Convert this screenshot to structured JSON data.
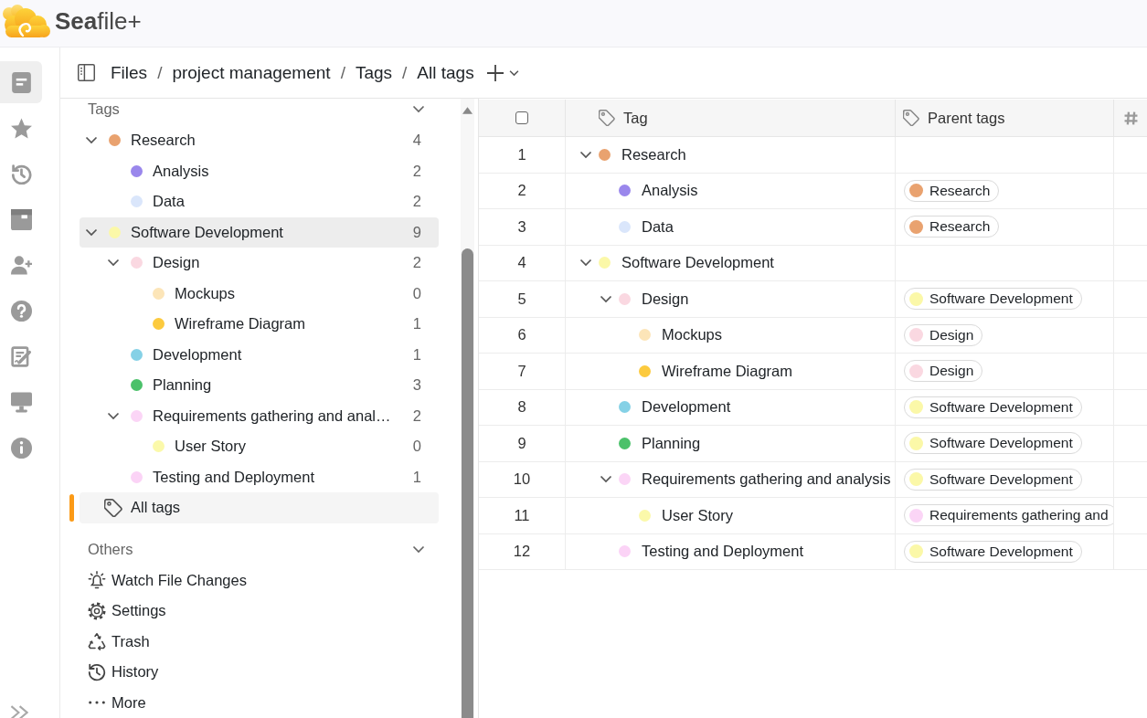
{
  "header": {
    "logo": "**Sea**file+"
  },
  "nav_rail": {
    "items": [
      {
        "selected": true
      },
      {
        "selected": false
      },
      {
        "selected": false
      },
      {
        "selected": false
      },
      {
        "selected": false
      },
      {
        "selected": false
      },
      {
        "selected": false
      },
      {
        "selected": false
      },
      {
        "selected": false
      }
    ]
  },
  "breadcrumb": [
    {
      "kind": "link",
      "text": "Files"
    },
    {
      "kind": "separator",
      "text": "/"
    },
    {
      "kind": "link",
      "text": "project management"
    },
    {
      "kind": "separator",
      "text": "/"
    },
    {
      "kind": "link",
      "text": "Tags"
    },
    {
      "kind": "separator",
      "text": "/"
    },
    {
      "kind": "current",
      "text": "All tags"
    }
  ],
  "sidebar": {
    "tags_section": {
      "title": "Tags",
      "expanded": true,
      "items": [
        {
          "name": "Research",
          "color": "#e9a26f",
          "count": "4",
          "expanded": true,
          "highlighted": false,
          "children": [
            {
              "name": "Analysis",
              "color": "#9a87ec",
              "count": "2",
              "highlighted": false
            },
            {
              "name": "Data",
              "color": "#dae6fb",
              "count": "2",
              "highlighted": false
            }
          ]
        },
        {
          "name": "Software Development",
          "color": "#fbf8a8",
          "count": "9",
          "expanded": true,
          "highlighted": true,
          "children": [
            {
              "name": "Design",
              "color": "#fad8e1",
              "count": "2",
              "expanded": true,
              "highlighted": false,
              "children": [
                {
                  "name": "Mockups",
                  "color": "#fce5b8",
                  "count": "0",
                  "highlighted": false
                },
                {
                  "name": "Wireframe Diagram",
                  "color": "#fcca3e",
                  "count": "1",
                  "highlighted": false
                }
              ]
            },
            {
              "name": "Development",
              "color": "#85d1e6",
              "count": "1",
              "highlighted": false
            },
            {
              "name": "Planning",
              "color": "#4bc16a",
              "count": "3",
              "highlighted": false
            },
            {
              "name": "Requirements gathering and anal…",
              "color": "#fbd5f6",
              "count": "2",
              "expanded": true,
              "highlighted": false,
              "children": [
                {
                  "name": "User Story",
                  "color": "#fbf9aa",
                  "count": "0",
                  "highlighted": false
                }
              ]
            },
            {
              "name": "Testing and Deployment",
              "color": "#fbd3f6",
              "count": "1",
              "highlighted": false
            }
          ]
        }
      ],
      "all_tags": {
        "label": "All tags",
        "selected": true
      }
    },
    "others_section": {
      "title": "Others",
      "expanded": true,
      "items": [
        {
          "label": "Watch File Changes"
        },
        {
          "label": "Settings"
        },
        {
          "label": "Trash"
        },
        {
          "label": "History"
        },
        {
          "label": "More"
        }
      ]
    }
  },
  "table": {
    "columns": [
      {
        "kind": "checkbox",
        "checked": false
      },
      {
        "kind": "tag",
        "label": "Tag"
      },
      {
        "kind": "tag",
        "label": "Parent tags"
      },
      {
        "kind": "number"
      }
    ],
    "rows": [
      {
        "number": "1",
        "name": "Research",
        "color": "#e9a26f",
        "expanded": true,
        "children": [
          {
            "number": "2",
            "name": "Analysis",
            "color": "#9a87ec",
            "parents": [
              {
                "name": "Research",
                "color": "#e9a26f"
              }
            ]
          },
          {
            "number": "3",
            "name": "Data",
            "color": "#dae6fb",
            "parents": [
              {
                "name": "Research",
                "color": "#e9a26f"
              }
            ]
          }
        ]
      },
      {
        "number": "4",
        "name": "Software Development",
        "color": "#fbf8a8",
        "expanded": true,
        "children": [
          {
            "number": "5",
            "name": "Design",
            "color": "#fad8e1",
            "expanded": true,
            "parents": [
              {
                "name": "Software Development",
                "color": "#fbf8a8"
              }
            ],
            "children": [
              {
                "number": "6",
                "name": "Mockups",
                "color": "#fce5b8",
                "parents": [
                  {
                    "name": "Design",
                    "color": "#fad8e1"
                  }
                ]
              },
              {
                "number": "7",
                "name": "Wireframe Diagram",
                "color": "#fcca3e",
                "parents": [
                  {
                    "name": "Design",
                    "color": "#fad8e1"
                  }
                ]
              }
            ]
          },
          {
            "number": "8",
            "name": "Development",
            "color": "#85d1e6",
            "parents": [
              {
                "name": "Software Development",
                "color": "#fbf8a8"
              }
            ]
          },
          {
            "number": "9",
            "name": "Planning",
            "color": "#4bc16a",
            "parents": [
              {
                "name": "Software Development",
                "color": "#fbf8a8"
              }
            ]
          },
          {
            "number": "10",
            "name": "Requirements gathering and analysis",
            "color": "#fbd5f6",
            "expanded": true,
            "parents": [
              {
                "name": "Software Development",
                "color": "#fbf8a8"
              }
            ],
            "children": [
              {
                "number": "11",
                "name": "User Story",
                "color": "#fbf9aa",
                "parents": [
                  {
                    "name": "Requirements gathering and",
                    "color": "#fbd5f6"
                  }
                ]
              }
            ]
          },
          {
            "number": "12",
            "name": "Testing and Deployment",
            "color": "#fbd3f6",
            "parents": [
              {
                "name": "Software Development",
                "color": "#fbf8a8"
              }
            ]
          }
        ]
      }
    ]
  }
}
